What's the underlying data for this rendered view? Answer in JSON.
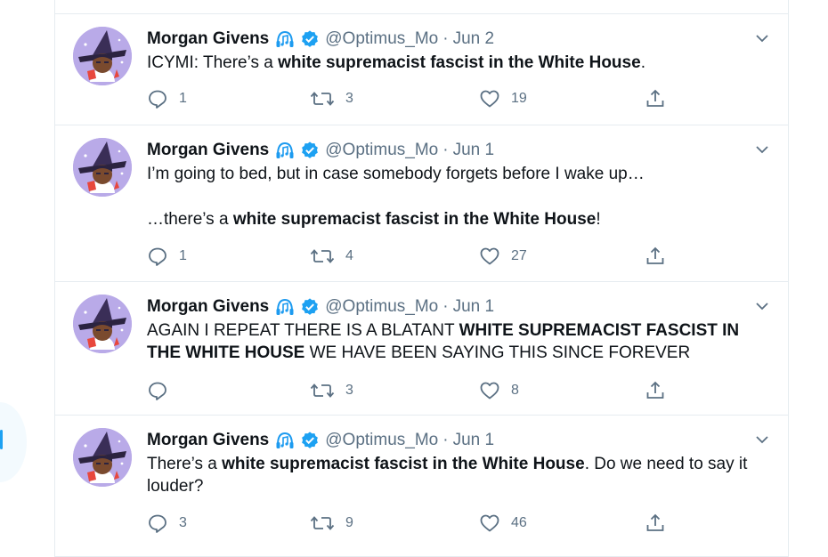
{
  "colors": {
    "accent": "#1da1f2",
    "muted": "#5b7083",
    "text": "#0f1419",
    "border": "#e6ecf0"
  },
  "tweets": [
    {
      "author": "Morgan Givens",
      "handle": "@Optimus_Mo",
      "sep": "·",
      "date": "Jun 2",
      "lines": [
        [
          {
            "t": "ICYMI: There’s a "
          },
          {
            "t": "white supremacist fascist in the White House",
            "b": true
          },
          {
            "t": "."
          }
        ]
      ],
      "replies": "1",
      "retweets": "3",
      "likes": "19"
    },
    {
      "author": "Morgan Givens",
      "handle": "@Optimus_Mo",
      "sep": "·",
      "date": "Jun 1",
      "lines": [
        [
          {
            "t": "I’m going to bed, but in case somebody forgets before I wake up…"
          }
        ],
        [
          {
            "t": "…there’s a "
          },
          {
            "t": "white supremacist fascist in the White House",
            "b": true
          },
          {
            "t": "!"
          }
        ]
      ],
      "replies": "1",
      "retweets": "4",
      "likes": "27"
    },
    {
      "author": "Morgan Givens",
      "handle": "@Optimus_Mo",
      "sep": "·",
      "date": "Jun 1",
      "lines": [
        [
          {
            "t": "AGAIN I REPEAT THERE IS A BLATANT "
          },
          {
            "t": "WHITE SUPREMACIST FASCIST IN THE WHITE HOUSE",
            "b": true
          },
          {
            "t": " WE HAVE BEEN SAYING THIS SINCE FOREVER"
          }
        ]
      ],
      "replies": "",
      "retweets": "3",
      "likes": "8"
    },
    {
      "author": "Morgan Givens",
      "handle": "@Optimus_Mo",
      "sep": "·",
      "date": "Jun 1",
      "lines": [
        [
          {
            "t": "There’s a "
          },
          {
            "t": "white supremacist fascist in the White House",
            "b": true
          },
          {
            "t": ". Do we need to say it louder?"
          }
        ]
      ],
      "replies": "3",
      "retweets": "9",
      "likes": "46"
    }
  ]
}
